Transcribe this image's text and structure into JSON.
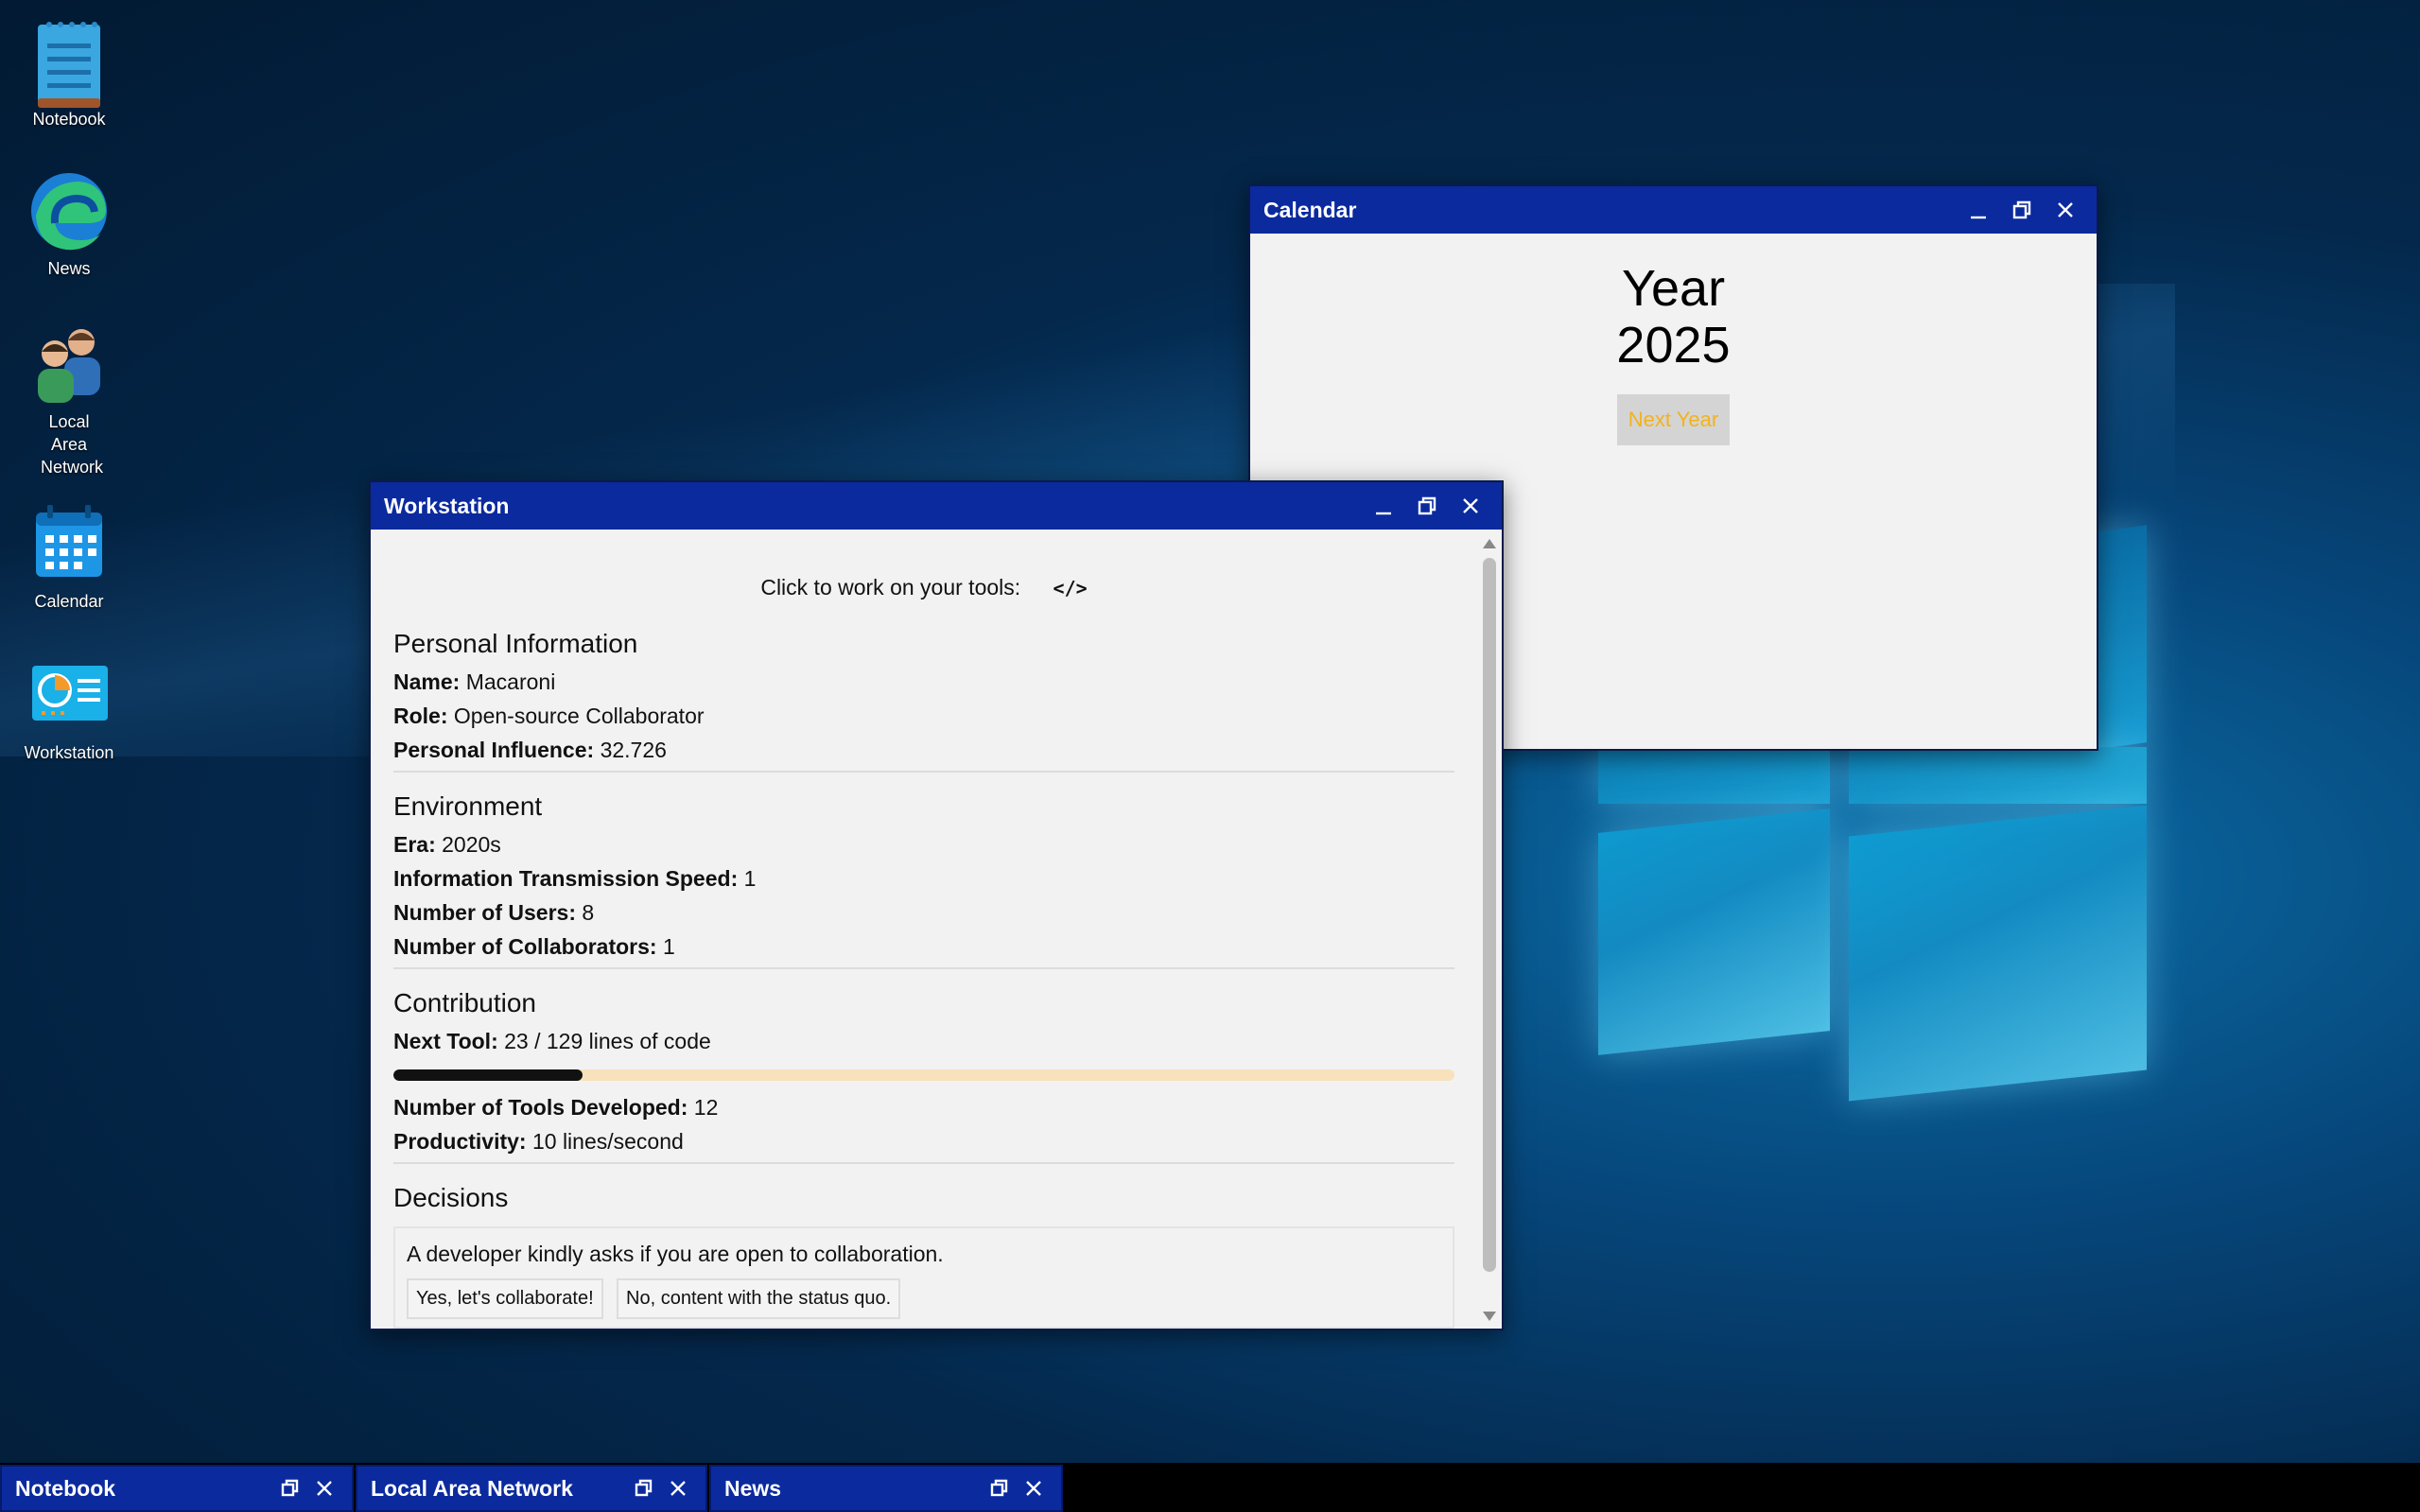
{
  "desktop": {
    "icons": [
      {
        "label": "Notebook",
        "icon": "notebook-icon"
      },
      {
        "label": "News",
        "icon": "edge-browser-icon"
      },
      {
        "label": "Local Area Network",
        "icon": "users-network-icon"
      },
      {
        "label": "Calendar",
        "icon": "calendar-icon"
      },
      {
        "label": "Workstation",
        "icon": "workstation-dashboard-icon"
      }
    ]
  },
  "calendar_window": {
    "title": "Calendar",
    "year_label": "Year",
    "year_value": "2025",
    "next_year_label": "Next Year"
  },
  "workstation_window": {
    "title": "Workstation",
    "tools_prompt": "Click to work on your tools:",
    "tools_icon": "</>",
    "personal": {
      "heading": "Personal Information",
      "name_label": "Name:",
      "name_value": "Macaroni",
      "role_label": "Role:",
      "role_value": "Open-source Collaborator",
      "influence_label": "Personal Influence:",
      "influence_value": "32.726"
    },
    "environment": {
      "heading": "Environment",
      "era_label": "Era:",
      "era_value": "2020s",
      "speed_label": "Information Transmission Speed:",
      "speed_value": "1",
      "users_label": "Number of Users:",
      "users_value": "8",
      "collab_label": "Number of Collaborators:",
      "collab_value": "1"
    },
    "contribution": {
      "heading": "Contribution",
      "next_tool_label": "Next Tool:",
      "next_tool_value": "23 / 129 lines of code",
      "progress_fraction": 0.178,
      "tools_label": "Number of Tools Developed:",
      "tools_value": "12",
      "productivity_label": "Productivity:",
      "productivity_value": "10 lines/second"
    },
    "decisions": {
      "heading": "Decisions",
      "prompt": "A developer kindly asks if you are open to collaboration.",
      "yes_label": "Yes, let's collaborate!",
      "no_label": "No, content with the status quo."
    }
  },
  "taskbar": {
    "items": [
      {
        "label": "Notebook"
      },
      {
        "label": "Local Area Network"
      },
      {
        "label": "News"
      }
    ]
  },
  "colors": {
    "titlebar": "#0b2a9e",
    "next_year_text": "#f3b21c",
    "progress_fill": "#111111",
    "progress_track": "#f7e2bc"
  }
}
